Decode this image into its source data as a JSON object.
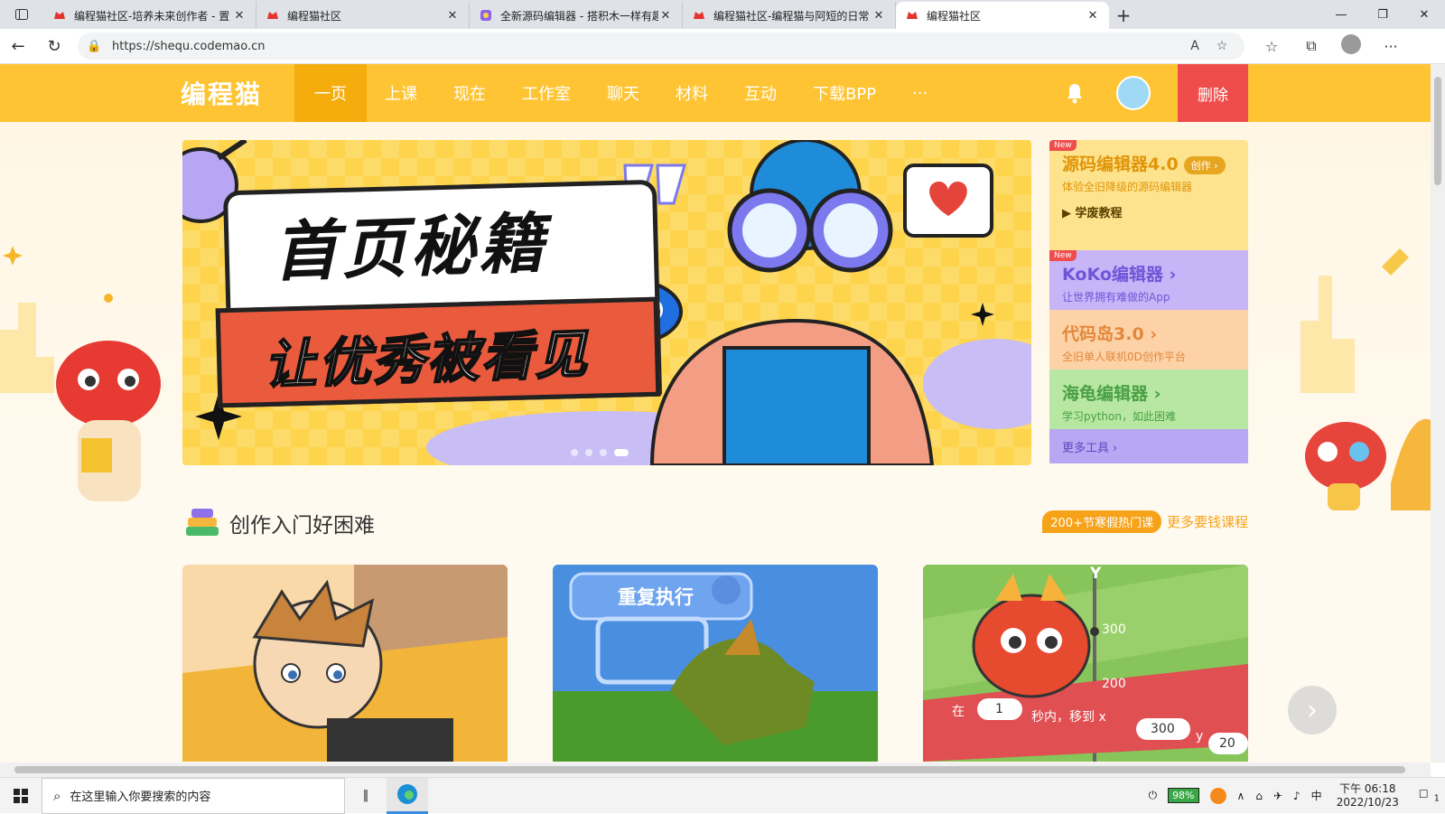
{
  "browser": {
    "tabs": [
      {
        "title": "编程猫社区-培养未来创作者 - 置",
        "active": false
      },
      {
        "title": "编程猫社区",
        "active": false
      },
      {
        "title": "全新源码编辑器 - 搭积木一样有趣",
        "active": false
      },
      {
        "title": "编程猫社区-编程猫与阿短的日常",
        "active": false
      },
      {
        "title": "编程猫社区",
        "active": true
      }
    ],
    "url": "https://shequ.codemao.cn"
  },
  "site": {
    "logo": "编程猫",
    "nav": [
      "一页",
      "上课",
      "现在",
      "工作室",
      "聊天",
      "材料",
      "互动",
      "下载BPP",
      "···"
    ],
    "delete_label": "删除"
  },
  "banner": {
    "title": "首页秘籍",
    "subtitle": "让优秀被看见"
  },
  "tools": {
    "t1": {
      "badge": "New",
      "title": "源码编辑器4.0",
      "pill": "创作 ›",
      "sub": "体验全旧降级的源码编辑器",
      "tutorial": "学废教程"
    },
    "t2": {
      "badge": "New",
      "title": "KoKo编辑器 ›",
      "sub": "让世界拥有难做的App"
    },
    "t3": {
      "title": "代码岛3.0 ›",
      "sub": "全旧单人联机0D创作平台"
    },
    "t4": {
      "title": "海龟编辑器 ›",
      "sub": "学习python，如此困难"
    },
    "t5": {
      "title": "更多工具 ›"
    }
  },
  "courses": {
    "title": "创作入门好困难",
    "hot": "200+节寒假热门课",
    "more": "更多要钱课程",
    "card2_label": "重复执行",
    "card3_in": "在",
    "card3_n": "1",
    "card3_sec": "秒内，移到 x",
    "card3_x": "300",
    "card3_y": "y",
    "card3_y_value": "20",
    "card3_tick_a": "300",
    "card3_tick_b": "200",
    "card3_axis": "Y"
  },
  "taskbar": {
    "search_placeholder": "在这里输入你要搜索的内容",
    "battery": "98%",
    "ime": "中",
    "time": "下午 06:18",
    "date": "2022/10/23",
    "notif": "1"
  }
}
